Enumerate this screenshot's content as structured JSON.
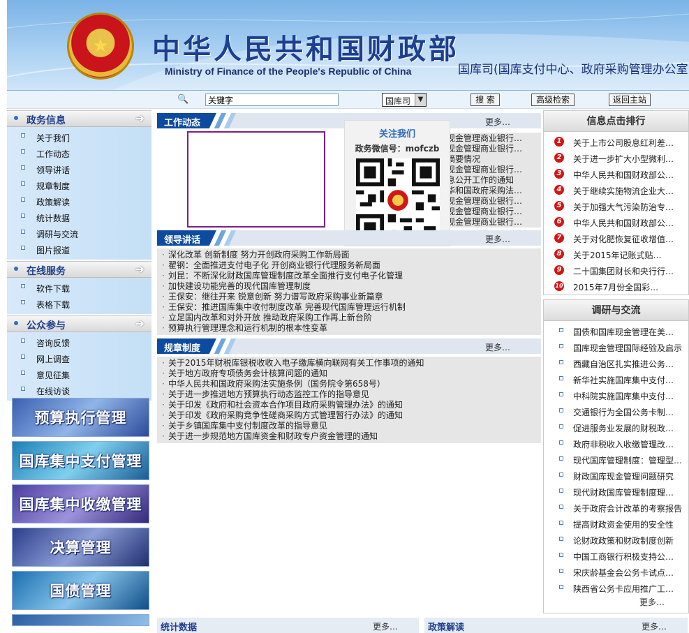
{
  "header": {
    "title_cn": "中华人民共和国财政部",
    "title_en": "Ministry of Finance of the People's Republic of China",
    "department": "国库司(国库支付中心、政府采购管理办公室)"
  },
  "search": {
    "value": "关键字",
    "scope": "国库司",
    "search_btn": "搜 索",
    "advanced_btn": "高级检索",
    "home_btn": "返回主站"
  },
  "sidebar": {
    "sections": [
      {
        "label": "政务信息",
        "items": [
          "关于我们",
          "工作动态",
          "领导讲话",
          "规章制度",
          "政策解读",
          "统计数据",
          "调研与交流",
          "图片报道"
        ]
      },
      {
        "label": "在线服务",
        "items": [
          "软件下载",
          "表格下载"
        ]
      },
      {
        "label": "公众参与",
        "items": [
          "咨询反馈",
          "网上调查",
          "意见征集",
          "在线访谈"
        ]
      }
    ],
    "promos": [
      "预算执行管理",
      "国库集中支付管理",
      "国库集中收缴管理",
      "决算管理",
      "国债管理"
    ]
  },
  "work_news": {
    "title": "工作动态",
    "more": "更多…",
    "items": [
      "现金管理商业银行…",
      "现金管理商业银行…",
      "摘要情况",
      "现金管理商业银行…",
      "息公开工作的通知",
      "华和国政府采购法…",
      "现金管理商业银行…",
      "现金管理商业银行…",
      "现金管理商业银行…",
      "现金管理商业银行…"
    ]
  },
  "follow": {
    "title": "关注我们",
    "wechat": "政务微信号：mofczb"
  },
  "speeches": {
    "title": "领导讲话",
    "more": "更多…",
    "items": [
      "深化改革 创新制度 努力开创政府采购工作新局面",
      "翟钢：全面推进支付电子化 开创商业银行代理服务新局面",
      "刘昆：不断深化财政国库管理制度改革全面推行支付电子化管理",
      "加快建设功能完善的现代国库管理制度",
      "王保安：继往开来 锐意创新 努力谱写政府采购事业新篇章",
      "王保安：推进国库集中收付制度改革 完善现代国库管理运行机制",
      "立足国内改革和对外开放 推动政府采购工作再上新台阶",
      "预算执行管理理念和运行机制的根本性变革"
    ]
  },
  "rules": {
    "title": "规章制度",
    "more": "更多…",
    "items": [
      "关于2015年财税库银税收收入电子缴库横向联网有关工作事项的通知",
      "关于地方政府专项债务会计核算问题的通知",
      "中华人民共和国政府采购法实施条例（国务院令第658号）",
      "关于进一步推进地方预算执行动态监控工作的指导意见",
      "关于印发《政府和社会资本合作项目政府采购管理办法》的通知",
      "关于印发《政府采购竞争性磋商采购方式管理暂行办法》的通知",
      "关于乡镇国库集中支付制度改革的指导意见",
      "关于进一步规范地方国库资金和财政专户资金管理的通知"
    ]
  },
  "bottom": {
    "stats_title": "统计数据",
    "policy_title": "政策解读",
    "more": "更多…"
  },
  "ranking": {
    "title": "信息点击排行",
    "items": [
      "关于上市公司股息红利差…",
      "关于进一步扩大小型微利…",
      "中华人民共和国财政部公…",
      "关于继续实施物流企业大…",
      "关于加强大气污染防治专…",
      "中华人民共和国财政部公…",
      "关于对化肥恢复征收增值…",
      "关于2015年记账式贴…",
      "二十国集团财长和央行行…",
      "2015年7月份全国彩…"
    ]
  },
  "research": {
    "title": "调研与交流",
    "more": "更多…",
    "items": [
      "国债和国库现金管理在美…",
      "国库现金管理国际经验及启示",
      "西藏自治区扎实推进公务…",
      "新华社实施国库集中支付…",
      "中科院实施国库集中支付…",
      "交通银行为全国公务卡制…",
      "促进服务业发展的财税政…",
      "政府非税收入收缴管理改…",
      "现代国库管理制度：管理型…",
      "财政国库现金管理问题研究",
      "现代财政国库管理制度理…",
      "关于政府会计改革的考察报告",
      "提高财政资金使用的安全性",
      "论财政政策和财政制度创新",
      "中国工商银行积极支持公…",
      "宋庆龄基金会公务卡试点…",
      "陕西省公务卡应用推广工…"
    ]
  },
  "colors": {
    "primary": "#0d4ba0",
    "rank_red": "#d21616",
    "nav_bg": "#c4dff6"
  }
}
